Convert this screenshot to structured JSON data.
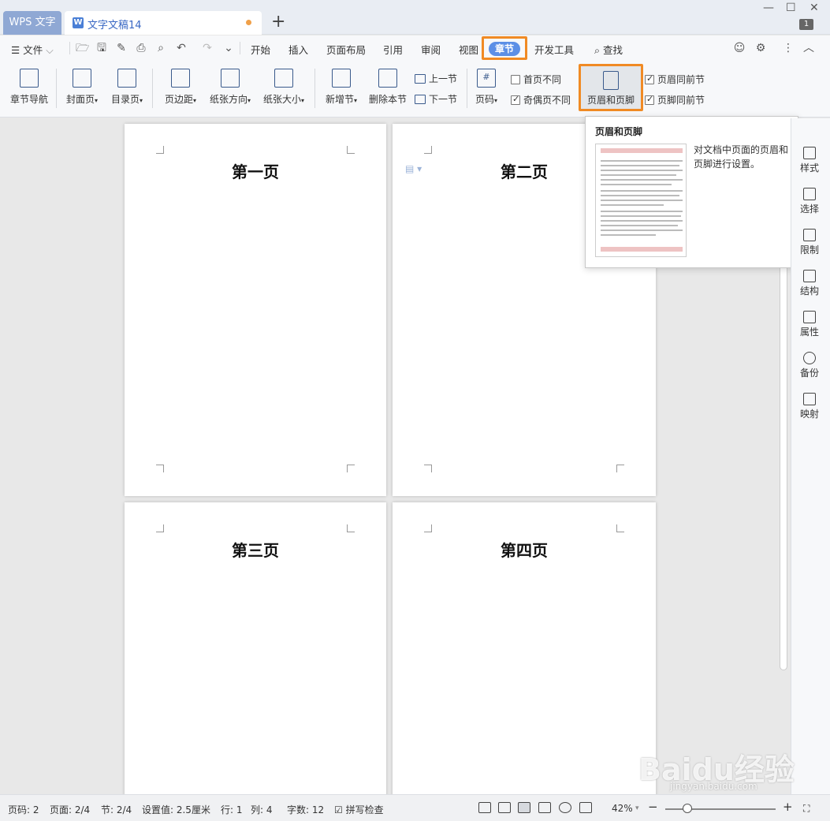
{
  "titlebar": {
    "app_tab": "WPS 文字",
    "doc_tab": "文字文稿14",
    "doc_icon": "W",
    "add_tab": "+",
    "badge": "1"
  },
  "menubar": {
    "file": "文件",
    "tabs": [
      "开始",
      "插入",
      "页面布局",
      "引用",
      "审阅",
      "视图",
      "章节",
      "开发工具"
    ],
    "search": "查找"
  },
  "ribbon": {
    "chapter_nav": "章节导航",
    "cover": "封面页",
    "toc": "目录页",
    "margin": "页边距",
    "orientation": "纸张方向",
    "size": "纸张大小",
    "new_section": "新增节",
    "delete_section": "删除本节",
    "prev_section": "上一节",
    "next_section": "下一节",
    "page_number": "页码",
    "first_diff": "首页不同",
    "odd_even_diff": "奇偶页不同",
    "header_footer": "页眉和页脚",
    "header_same_prev": "页眉同前节",
    "footer_same_prev": "页脚同前节"
  },
  "pages": [
    {
      "title": "第一页"
    },
    {
      "title": "第二页"
    },
    {
      "title": "第三页"
    },
    {
      "title": "第四页"
    }
  ],
  "tooltip": {
    "title": "页眉和页脚",
    "description": "对文档中页面的页眉和页脚进行设置。"
  },
  "sidebar": {
    "items": [
      "样式",
      "选择",
      "限制",
      "结构",
      "属性",
      "备份",
      "映射"
    ]
  },
  "status": {
    "page_num": "页码: 2",
    "pages": "页面: 2/4",
    "section": "节: 2/4",
    "setting": "设置值: 2.5厘米",
    "row": "行: 1",
    "col": "列: 4",
    "words": "字数: 12",
    "spell": "拼写检查",
    "zoom": "42%"
  },
  "watermark": {
    "brand": "Baidu经验",
    "url": "jingyan.baidu.com"
  }
}
